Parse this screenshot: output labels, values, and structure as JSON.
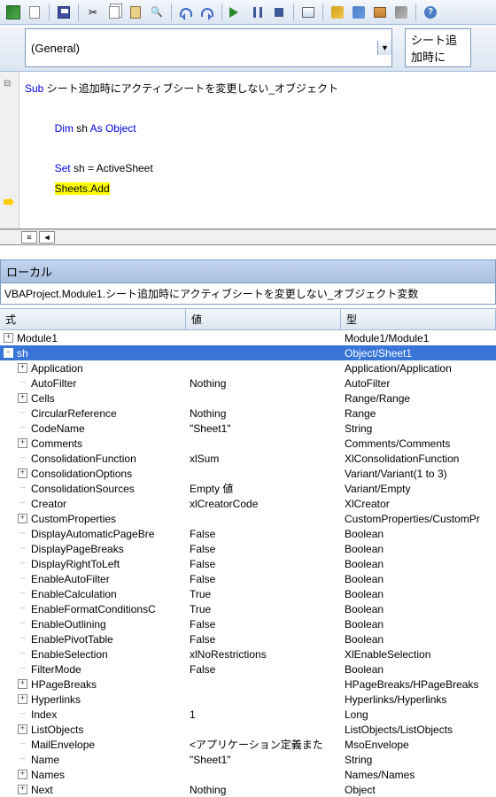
{
  "toolbar": {
    "help_char": "?"
  },
  "dropdown": {
    "general": "(General)",
    "proc": "シート追加時に"
  },
  "code": {
    "sub_kw": "Sub",
    "sub_name": " シート追加時にアクティブシートを変更しない_オブジェクト",
    "dim_kw": "Dim",
    "dim_var": " sh ",
    "as_obj": "As Object",
    "set_kw": "Set",
    "set_rest": " sh = ActiveSheet",
    "hl_line": "Sheets.Add"
  },
  "locals": {
    "title": "ローカル",
    "context": "VBAProject.Module1.シート追加時にアクティブシートを変更しない_オブジェクト変数",
    "col_expr": "式",
    "col_val": "値",
    "col_type": "型"
  },
  "rows": [
    {
      "d": 0,
      "t": "+",
      "n": "Module1",
      "v": "",
      "ty": "Module1/Module1"
    },
    {
      "d": 0,
      "t": "-",
      "n": "sh",
      "v": "",
      "ty": "Object/Sheet1",
      "sel": true
    },
    {
      "d": 1,
      "t": "+",
      "n": "Application",
      "v": "",
      "ty": "Application/Application"
    },
    {
      "d": 1,
      "t": "",
      "n": "AutoFilter",
      "v": "Nothing",
      "ty": "AutoFilter"
    },
    {
      "d": 1,
      "t": "+",
      "n": "Cells",
      "v": "",
      "ty": "Range/Range"
    },
    {
      "d": 1,
      "t": "",
      "n": "CircularReference",
      "v": "Nothing",
      "ty": "Range"
    },
    {
      "d": 1,
      "t": "",
      "n": "CodeName",
      "v": "\"Sheet1\"",
      "ty": "String"
    },
    {
      "d": 1,
      "t": "+",
      "n": "Comments",
      "v": "",
      "ty": "Comments/Comments"
    },
    {
      "d": 1,
      "t": "",
      "n": "ConsolidationFunction",
      "v": "xlSum",
      "ty": "XlConsolidationFunction"
    },
    {
      "d": 1,
      "t": "+",
      "n": "ConsolidationOptions",
      "v": "",
      "ty": "Variant/Variant(1 to 3)"
    },
    {
      "d": 1,
      "t": "",
      "n": "ConsolidationSources",
      "v": "Empty 値",
      "ty": "Variant/Empty"
    },
    {
      "d": 1,
      "t": "",
      "n": "Creator",
      "v": "xlCreatorCode",
      "ty": "XlCreator"
    },
    {
      "d": 1,
      "t": "+",
      "n": "CustomProperties",
      "v": "",
      "ty": "CustomProperties/CustomPr"
    },
    {
      "d": 1,
      "t": "",
      "n": "DisplayAutomaticPageBre",
      "v": "False",
      "ty": "Boolean"
    },
    {
      "d": 1,
      "t": "",
      "n": "DisplayPageBreaks",
      "v": "False",
      "ty": "Boolean"
    },
    {
      "d": 1,
      "t": "",
      "n": "DisplayRightToLeft",
      "v": "False",
      "ty": "Boolean"
    },
    {
      "d": 1,
      "t": "",
      "n": "EnableAutoFilter",
      "v": "False",
      "ty": "Boolean"
    },
    {
      "d": 1,
      "t": "",
      "n": "EnableCalculation",
      "v": "True",
      "ty": "Boolean"
    },
    {
      "d": 1,
      "t": "",
      "n": "EnableFormatConditionsC",
      "v": "True",
      "ty": "Boolean"
    },
    {
      "d": 1,
      "t": "",
      "n": "EnableOutlining",
      "v": "False",
      "ty": "Boolean"
    },
    {
      "d": 1,
      "t": "",
      "n": "EnablePivotTable",
      "v": "False",
      "ty": "Boolean"
    },
    {
      "d": 1,
      "t": "",
      "n": "EnableSelection",
      "v": "xlNoRestrictions",
      "ty": "XlEnableSelection"
    },
    {
      "d": 1,
      "t": "",
      "n": "FilterMode",
      "v": "False",
      "ty": "Boolean"
    },
    {
      "d": 1,
      "t": "+",
      "n": "HPageBreaks",
      "v": "",
      "ty": "HPageBreaks/HPageBreaks"
    },
    {
      "d": 1,
      "t": "+",
      "n": "Hyperlinks",
      "v": "",
      "ty": "Hyperlinks/Hyperlinks"
    },
    {
      "d": 1,
      "t": "",
      "n": "Index",
      "v": "1",
      "ty": "Long"
    },
    {
      "d": 1,
      "t": "+",
      "n": "ListObjects",
      "v": "",
      "ty": "ListObjects/ListObjects"
    },
    {
      "d": 1,
      "t": "",
      "n": "MailEnvelope",
      "v": "<アプリケーション定義また",
      "ty": "MsoEnvelope"
    },
    {
      "d": 1,
      "t": "",
      "n": "Name",
      "v": "\"Sheet1\"",
      "ty": "String"
    },
    {
      "d": 1,
      "t": "+",
      "n": "Names",
      "v": "",
      "ty": "Names/Names"
    },
    {
      "d": 1,
      "t": "+",
      "n": "Next",
      "v": "Nothing",
      "ty": "Object"
    }
  ]
}
